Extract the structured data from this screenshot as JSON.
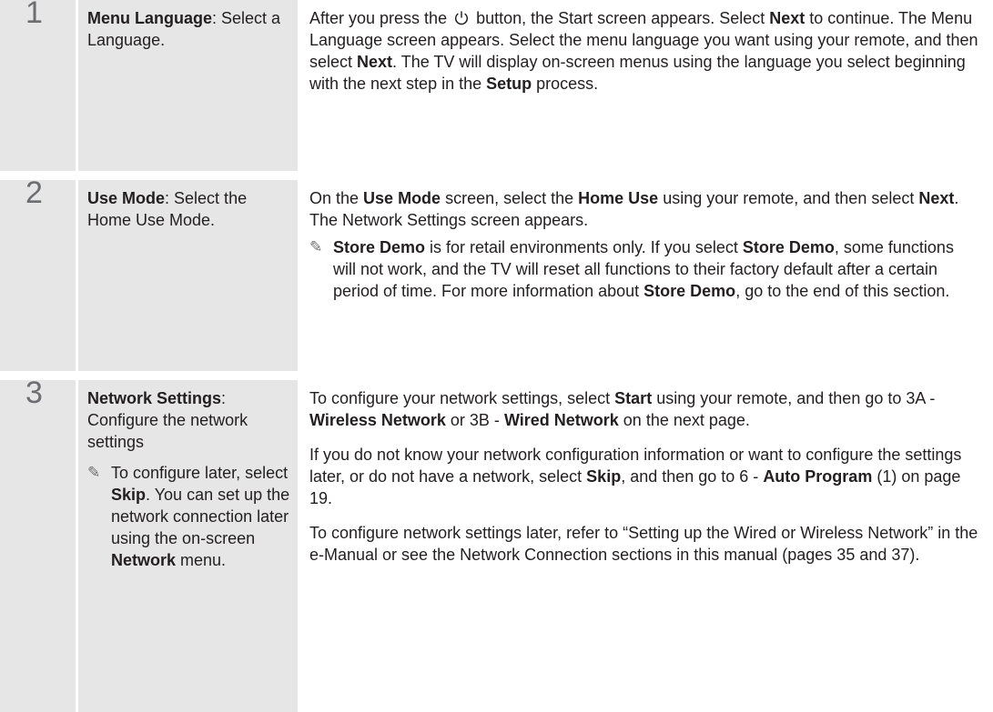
{
  "steps": [
    {
      "number": "1",
      "title_bold": "Menu Language",
      "title_rest": ": Select a Language.",
      "p1_a": "After you press the ",
      "power_icon": "power-icon",
      "p1_b": " button, the Start screen appears. Select ",
      "p1_next1": "Next",
      "p1_c": " to continue. The Menu Language screen appears. Select the menu language you want using your remote, and then select ",
      "p1_next2": "Next",
      "p1_d": ". The TV will display on-screen menus using the language you select beginning with the next step in the ",
      "p1_setup": "Setup",
      "p1_e": " process."
    },
    {
      "number": "2",
      "title_bold": "Use Mode",
      "title_rest": ": Select the Home Use Mode.",
      "p1_a": "On the ",
      "p1_usemode": "Use Mode",
      "p1_b": " screen, select the ",
      "p1_homeuse": "Home Use",
      "p1_c": " using your remote, and then select ",
      "p1_next": "Next",
      "p1_d": ". The Network Settings screen appears.",
      "note_icon": "pencil-note-icon",
      "note_storedemo1": "Store Demo",
      "note_a": " is for retail environments only. If you select ",
      "note_storedemo2": "Store Demo",
      "note_b": ", some functions will not work, and the TV will reset all functions to their factory default after a certain period of time. For more information about ",
      "note_storedemo3": "Store Demo",
      "note_c": ", go to the end of this section."
    },
    {
      "number": "3",
      "title_bold": "Network Settings",
      "title_rest": ": Configure the network settings",
      "title_note_a": "To configure later, select ",
      "title_note_skip": "Skip",
      "title_note_b": ". You can set up the network connection later using the on-screen ",
      "title_note_network": "Network",
      "title_note_c": " menu.",
      "note_icon": "pencil-note-icon",
      "p1_a": "To configure your network settings, select ",
      "p1_start": "Start",
      "p1_b": " using your remote, and then go to 3A - ",
      "p1_wireless": "Wireless Network",
      "p1_c": " or 3B - ",
      "p1_wired": "Wired Network",
      "p1_d": " on the next page.",
      "p2_a": "If you do not know your network configuration information or want to configure the settings later, or do not have a network, select ",
      "p2_skip": "Skip",
      "p2_b": ", and then go to 6 - ",
      "p2_autoprogram": "Auto Program",
      "p2_c": " (1) on page 19.",
      "p3": "To configure network settings later, refer to “Setting up the Wired or Wireless Network” in the e-Manual or see the Network Connection sections in this manual (pages 35 and 37)."
    }
  ]
}
